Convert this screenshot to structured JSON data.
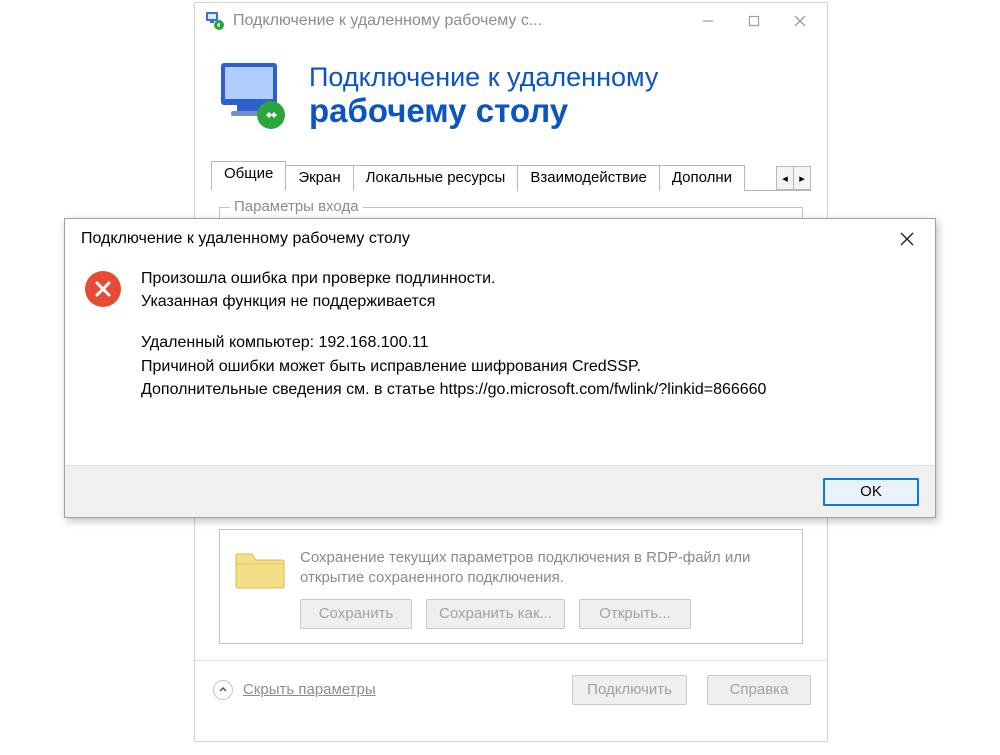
{
  "main": {
    "titlebar": "Подключение к удаленному рабочему с...",
    "header_line1": "Подключение к удаленному",
    "header_line2": "рабочему столу",
    "tabs": [
      {
        "label": "Общие"
      },
      {
        "label": "Экран"
      },
      {
        "label": "Локальные ресурсы"
      },
      {
        "label": "Взаимодействие"
      },
      {
        "label": "Дополни"
      }
    ],
    "group_partial_legend": "Параметры входа",
    "save_desc": "Сохранение текущих параметров подключения в RDP-файл или открытие сохраненного подключения.",
    "btn_save": "Сохранить",
    "btn_save_as": "Сохранить как...",
    "btn_open": "Открыть...",
    "hide_params": "Скрыть параметры",
    "btn_connect": "Подключить",
    "btn_help": "Справка"
  },
  "error": {
    "title": "Подключение к удаленному рабочему столу",
    "line1": "Произошла ошибка при проверке подлинности.",
    "line2": "Указанная функция не поддерживается",
    "line3": "Удаленный компьютер: 192.168.100.11",
    "line4": "Причиной ошибки может быть исправление шифрования CredSSP.",
    "line5": "Дополнительные сведения см. в статье https://go.microsoft.com/fwlink/?linkid=866660",
    "ok": "OK"
  }
}
